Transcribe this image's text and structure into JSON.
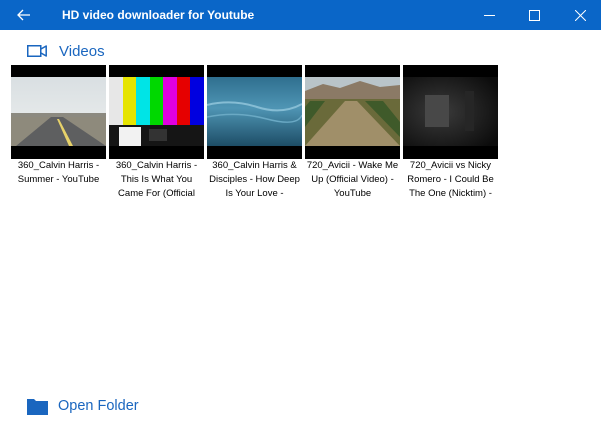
{
  "window": {
    "title": "HD video downloader for Youtube"
  },
  "section": {
    "title": "Videos"
  },
  "videos": [
    {
      "caption": "360_Calvin Harris - Summer - YouTube"
    },
    {
      "caption": "360_Calvin Harris - This Is What You Came For (Official"
    },
    {
      "caption": "360_Calvin Harris & Disciples - How Deep Is Your Love -"
    },
    {
      "caption": "720_Avicii - Wake Me Up (Official Video) - YouTube"
    },
    {
      "caption": "720_Avicii vs Nicky Romero - I Could Be The One (Nicktim) -"
    }
  ],
  "footer": {
    "open_folder_label": "Open Folder"
  },
  "colors": {
    "titlebar": "#0a66c8",
    "accent": "#1a66bf"
  }
}
